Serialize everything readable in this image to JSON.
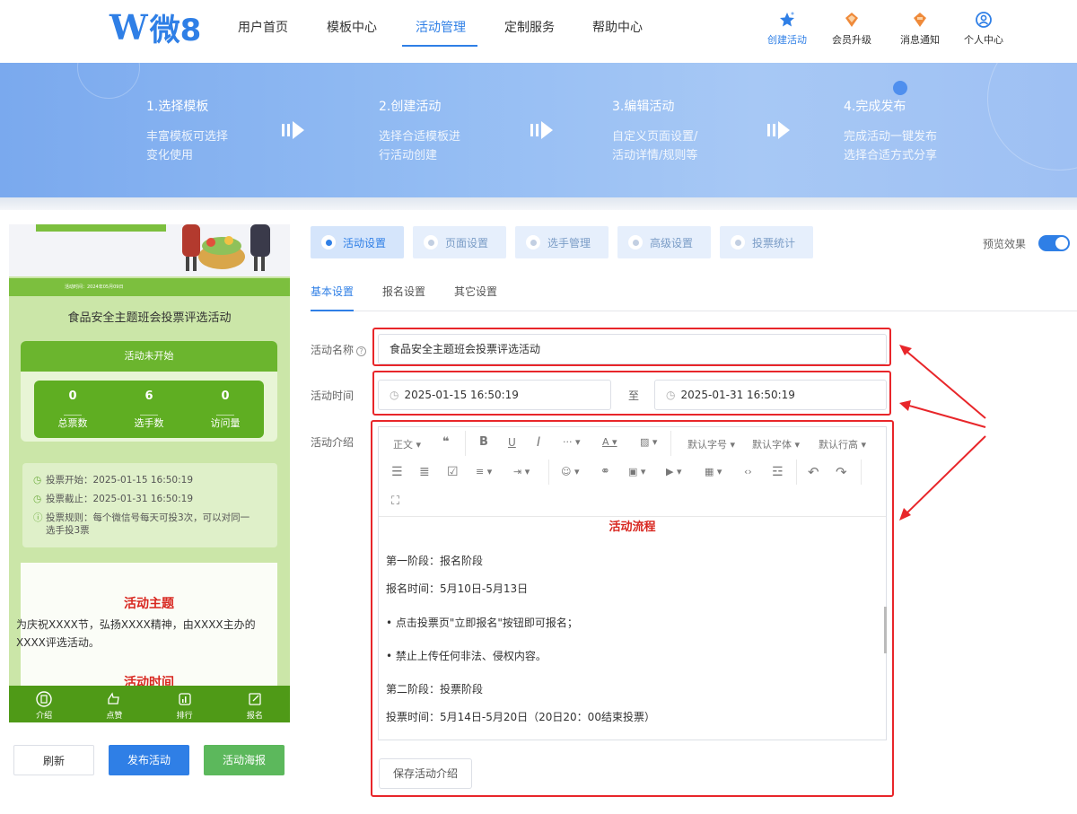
{
  "header": {
    "logo": "微8",
    "nav": [
      "用户首页",
      "模板中心",
      "活动管理",
      "定制服务",
      "帮助中心"
    ],
    "tools": [
      "创建活动",
      "会员升级",
      "消息通知",
      "个人中心"
    ]
  },
  "banner": {
    "steps": [
      {
        "title": "1.选择模板",
        "desc": [
          "丰富模板可选择",
          "变化使用"
        ]
      },
      {
        "title": "2.创建活动",
        "desc": [
          "选择合适模板进",
          "行活动创建"
        ]
      },
      {
        "title": "3.编辑活动",
        "desc": [
          "自定义页面设置/",
          "活动详情/规则等"
        ]
      },
      {
        "title": "4.完成发布",
        "desc": [
          "完成活动一键发布",
          "选择合适方式分享"
        ]
      }
    ]
  },
  "phone": {
    "strip": "活动时间：2024年05月09日",
    "title": "食品安全主题班会投票评选活动",
    "status": "活动未开始",
    "stats": [
      {
        "value": "0",
        "label": "总票数"
      },
      {
        "value": "6",
        "label": "选手数"
      },
      {
        "value": "0",
        "label": "访问量"
      }
    ],
    "info": [
      "投票开始：2025-01-15 16:50:19",
      "投票截止：2025-01-31 16:50:19",
      "投票规则：每个微信号每天可投3次，可以对同一选手投3票"
    ],
    "theme_title": "活动主题",
    "theme_text": "为庆祝XXXX节，弘扬XXXX精神，由XXXX主办的XXXX评选活动。",
    "time_title": "活动时间",
    "tabs": [
      "介绍",
      "点赞",
      "排行",
      "报名"
    ]
  },
  "buttons": {
    "refresh": "刷新",
    "publish": "发布活动",
    "poster": "活动海报"
  },
  "tabs": [
    "活动设置",
    "页面设置",
    "选手管理",
    "高级设置",
    "投票统计"
  ],
  "preview_label": "预览效果",
  "subtabs": [
    "基本设置",
    "报名设置",
    "其它设置"
  ],
  "form": {
    "name_label": "活动名称",
    "name_value": "食品安全主题班会投票评选活动",
    "time_label": "活动时间",
    "start": "2025-01-15 16:50:19",
    "to": "至",
    "end": "2025-01-31 16:50:19",
    "intro_label": "活动介绍"
  },
  "editor": {
    "toolbar": {
      "para": "正文",
      "font_size": "默认字号",
      "font_family": "默认字体",
      "line_height": "默认行高"
    },
    "content": {
      "title": "活动流程",
      "lines": [
        "第一阶段：报名阶段",
        "报名时间：5月10日-5月13日",
        "• 点击投票页\"立即报名\"按钮即可报名；",
        "• 禁止上传任何非法、侵权内容。",
        "第二阶段：投票阶段",
        "投票时间：5月14日-5月20日（20日20：00结束投票）"
      ]
    }
  },
  "save_label": "保存活动介绍"
}
